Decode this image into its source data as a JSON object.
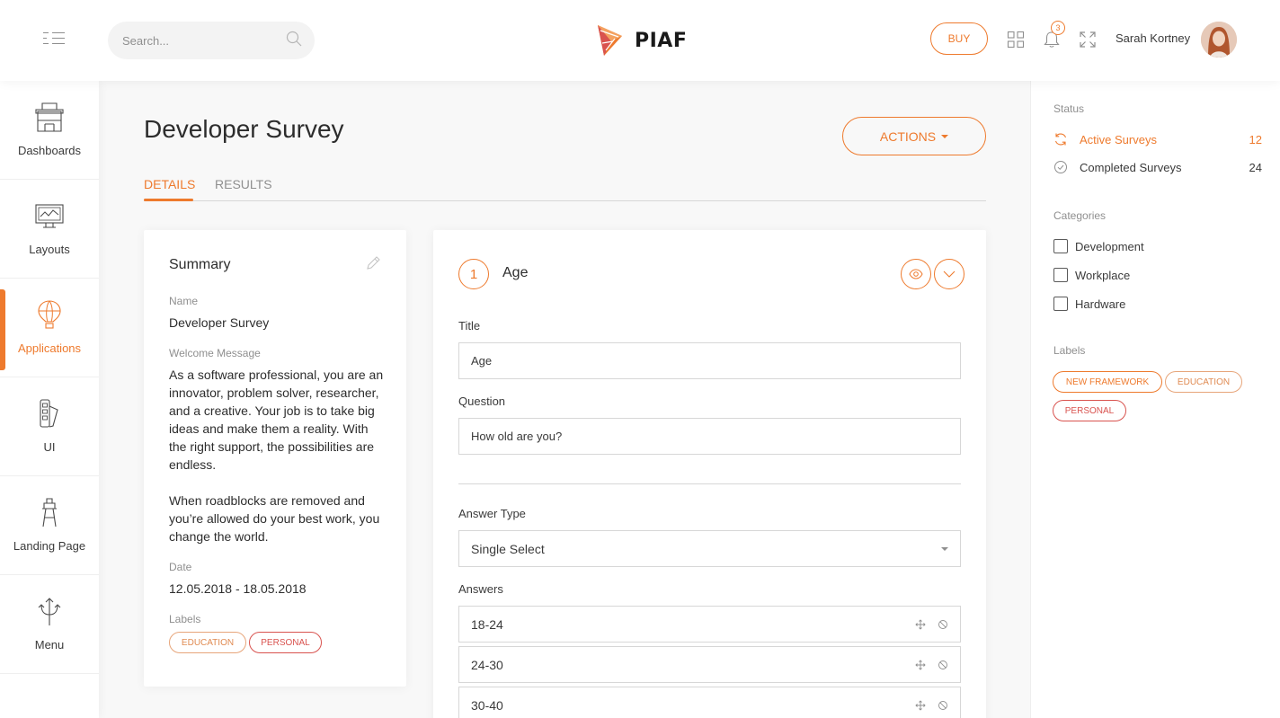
{
  "header": {
    "search_placeholder": "Search...",
    "logo_text": "PIAF",
    "buy_label": "BUY",
    "notification_count": "3",
    "user_name": "Sarah Kortney"
  },
  "sidebar": {
    "items": [
      {
        "label": "Dashboards",
        "icon": "shop-icon"
      },
      {
        "label": "Layouts",
        "icon": "monitor-icon"
      },
      {
        "label": "Applications",
        "icon": "air-balloon-icon",
        "active": true
      },
      {
        "label": "UI",
        "icon": "pantone-icon"
      },
      {
        "label": "Landing Page",
        "icon": "tower-icon"
      },
      {
        "label": "Menu",
        "icon": "split-arrows-icon"
      }
    ]
  },
  "main": {
    "title": "Developer Survey",
    "actions_label": "ACTIONS",
    "tabs": [
      {
        "label": "DETAILS",
        "active": true
      },
      {
        "label": "RESULTS",
        "active": false
      }
    ]
  },
  "summary": {
    "title": "Summary",
    "name_label": "Name",
    "name_value": "Developer Survey",
    "welcome_label": "Welcome Message",
    "welcome_p1": "As a software professional, you are an innovator, problem solver, researcher, and a creative. Your job is to take big ideas and make them a reality. With the right support, the possibilities are endless.",
    "welcome_p2": "When roadblocks are removed and you’re allowed do your best work, you change the world.",
    "date_label": "Date",
    "date_value": "12.05.2018 - 18.05.2018",
    "labels_label": "Labels",
    "labels": [
      "EDUCATION",
      "PERSONAL"
    ]
  },
  "question": {
    "number": "1",
    "title": "Age",
    "title_label": "Title",
    "title_value": "Age",
    "question_label": "Question",
    "question_value": "How old are you?",
    "answer_type_label": "Answer Type",
    "answer_type_value": "Single Select",
    "answers_label": "Answers",
    "answers": [
      "18-24",
      "24-30",
      "30-40"
    ]
  },
  "rightbar": {
    "status_label": "Status",
    "status": [
      {
        "label": "Active Surveys",
        "count": "12",
        "icon": "refresh-icon"
      },
      {
        "label": "Completed Surveys",
        "count": "24",
        "icon": "check-circle-icon"
      }
    ],
    "categories_label": "Categories",
    "categories": [
      "Development",
      "Workplace",
      "Hardware"
    ],
    "labels_label": "Labels",
    "labels": [
      "NEW FRAMEWORK",
      "EDUCATION",
      "PERSONAL"
    ]
  },
  "colors": {
    "accent": "#ee7a2d",
    "danger": "#d9534f",
    "text": "#3a3a3a",
    "muted": "#8f8f8f"
  }
}
